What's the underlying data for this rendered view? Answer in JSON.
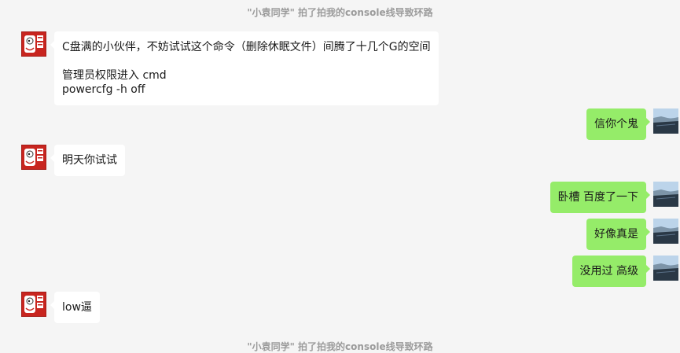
{
  "system_notices": {
    "top": "\"小袁同学\" 拍了拍我的console线导致环路",
    "bottom": "\"小袁同学\" 拍了拍我的console线导致环路"
  },
  "messages": [
    {
      "sender": "other",
      "text": "C盘满的小伙伴，不妨试试这个命令（删除休眠文件）间腾了十几个G的空间\n\n管理员权限进入 cmd\npowercfg -h off"
    },
    {
      "sender": "me",
      "text": "信你个鬼"
    },
    {
      "sender": "other",
      "text": "明天你试试"
    },
    {
      "sender": "me",
      "text": "卧槽 百度了一下"
    },
    {
      "sender": "me",
      "text": "好像真是"
    },
    {
      "sender": "me",
      "text": "没用过 高级"
    },
    {
      "sender": "other",
      "text": "low逼"
    }
  ],
  "avatars": {
    "other": {
      "icon": "red-cartoon-avatar-icon",
      "color": "#c8251f"
    },
    "me": {
      "icon": "ocean-photo-avatar-icon",
      "color": "#6a7e90"
    }
  },
  "colors": {
    "background": "#f5f5f5",
    "bubble_other": "#ffffff",
    "bubble_me": "#95ec69",
    "notice_text": "#9b9b9b"
  }
}
